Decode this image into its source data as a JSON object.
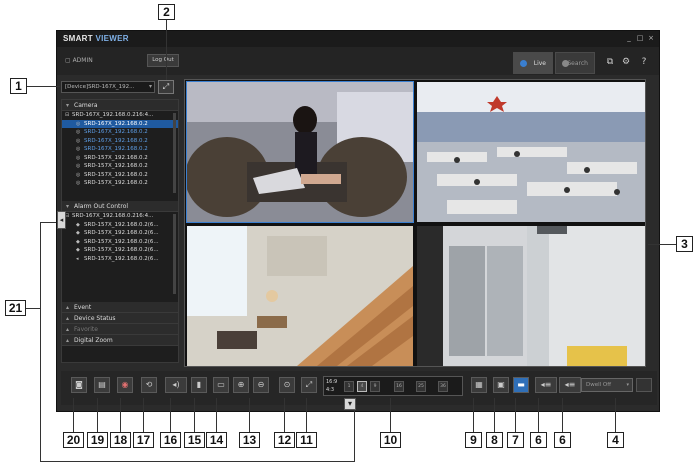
{
  "app": {
    "brand_a": "SMART",
    "brand_b": "VIEWER",
    "window_controls": [
      "_",
      "□",
      "×"
    ]
  },
  "header": {
    "user": "ADMIN",
    "logout_label": "Log Out",
    "tabs": [
      {
        "label": "Live",
        "dot_color": "#3a7fd0"
      },
      {
        "label": "Search",
        "dot_color": "#aaaaaa"
      }
    ],
    "icons": [
      "multi-monitor-icon",
      "gear-icon",
      "help-icon"
    ],
    "help_glyph": "?",
    "gear_glyph": "⚙",
    "monitor_glyph": "⧉"
  },
  "device_select": {
    "value": "[Device]SRD-167X_192...",
    "find_glyph": "⤢"
  },
  "panel": {
    "camera_title": "Camera",
    "camera_root": "SRD-167X_192.168.0.216:4...",
    "camera_rows": [
      {
        "label": "SRD-167X_192.168.0.2",
        "style": "sel"
      },
      {
        "label": "SRD-167X_192.168.0.2",
        "style": "blue"
      },
      {
        "label": "SRD-167X_192.168.0.2",
        "style": "blue"
      },
      {
        "label": "SRD-167X_192.168.0.2",
        "style": "blue"
      },
      {
        "label": "SRD-157X_192.168.0.2",
        "style": ""
      },
      {
        "label": "SRD-157X_192.168.0.2",
        "style": ""
      },
      {
        "label": "SRD-157X_192.168.0.2",
        "style": ""
      },
      {
        "label": "SRD-157X_192.168.0.2",
        "style": ""
      }
    ],
    "alarm_title": "Alarm Out Control",
    "alarm_root": "SRD-167X_192.168.0.216:4...",
    "alarm_rows": [
      "SRD-157X_192.168.0.2(6...",
      "SRD-157X_192.168.0.2(6...",
      "SRD-157X_192.168.0.2(6...",
      "SRD-157X_192.168.0.2(6...",
      "SRD-157X_192.168.0.2(6..."
    ],
    "event_title": "Event",
    "status_title": "Device Status",
    "favorite_title": "Favorite",
    "zoom_title": "Digital Zoom",
    "collapse_glyph": "◂"
  },
  "toolbar": {
    "ratio": "16:9",
    "ratio2": "4:3",
    "layouts": [
      "1",
      "4",
      "9",
      "16",
      "25",
      "36"
    ],
    "dwell_label": "Dwell Off",
    "expand_glyph": "▾"
  },
  "callouts": [
    "1",
    "2",
    "3",
    "4",
    "6",
    "6",
    "7",
    "8",
    "9",
    "10",
    "11",
    "12",
    "13",
    "14",
    "15",
    "16",
    "17",
    "18",
    "19",
    "20",
    "21"
  ]
}
